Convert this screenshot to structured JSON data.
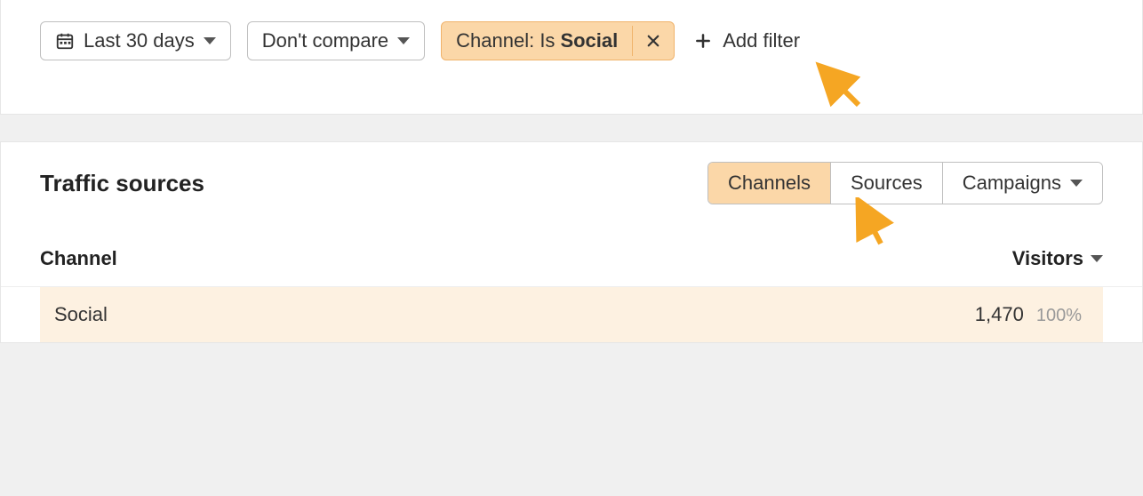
{
  "filters": {
    "date_range": "Last 30 days",
    "compare": "Don't compare",
    "channel": {
      "prefix": "Channel: Is",
      "value": "Social"
    },
    "add_filter": "Add filter"
  },
  "card": {
    "title": "Traffic sources",
    "tabs": {
      "channels": "Channels",
      "sources": "Sources",
      "campaigns": "Campaigns"
    }
  },
  "table": {
    "col_channel": "Channel",
    "col_visitors": "Visitors",
    "rows": [
      {
        "label": "Social",
        "visitors": "1,470",
        "pct": "100%"
      }
    ]
  }
}
